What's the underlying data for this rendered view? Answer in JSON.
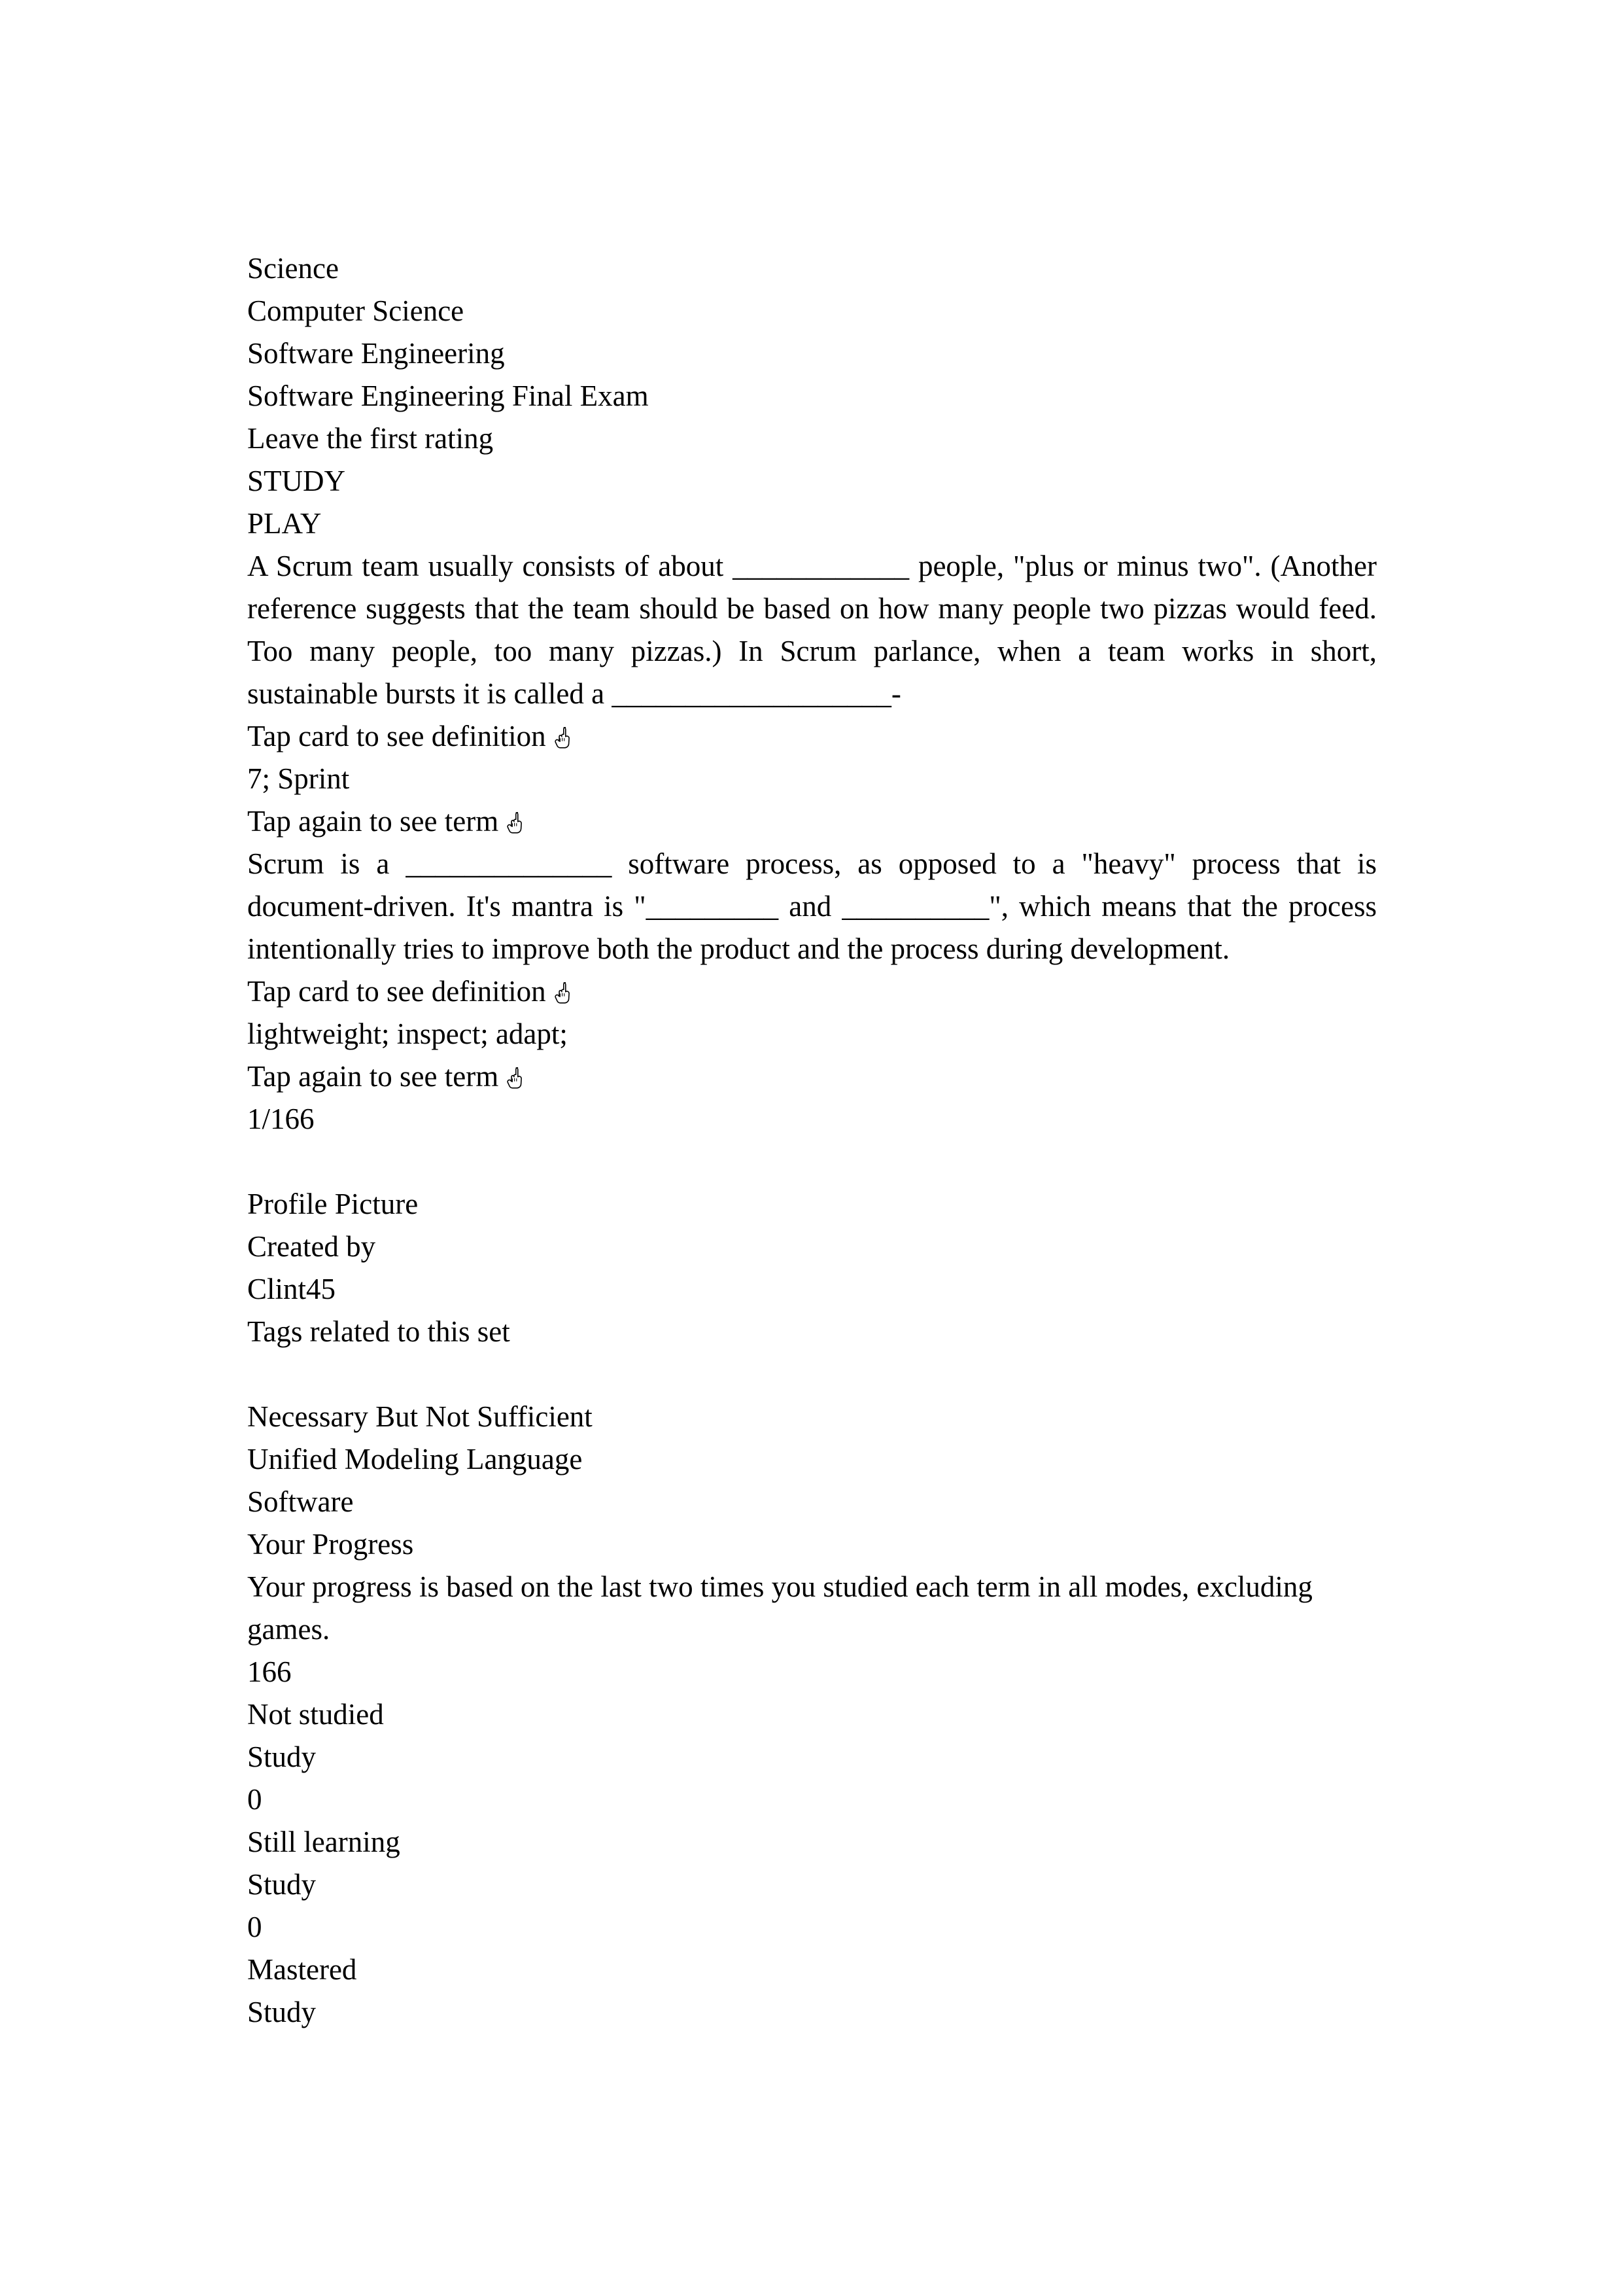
{
  "document": {
    "breadcrumb": [
      "Science",
      "Computer Science",
      "Software Engineering"
    ],
    "set_title": "Software Engineering Final Exam",
    "rating_prompt": "Leave the first rating",
    "mode_buttons": [
      "STUDY",
      "PLAY"
    ],
    "cards": [
      {
        "term_text": "A Scrum team usually consists of about ____________ people, \"plus or minus two\". (Another reference suggests that the team should be based on how many people two pizzas would feed. Too many people, too many pizzas.)\n\nIn Scrum parlance, when a team works in short, sustainable bursts it is called a ___________________-",
        "tap_front_label": "Tap card to see definition",
        "definition_text": "7; Sprint",
        "tap_back_label": "Tap again to see term"
      },
      {
        "term_text": "Scrum is a ______________ software process, as opposed to a \"heavy\" process that is document-driven. It's mantra is \"_________ and __________\", which means that the process intentionally tries to improve both the product and the process during development.",
        "tap_front_label": "Tap card to see definition",
        "definition_text": "lightweight; inspect; adapt;",
        "tap_back_label": "Tap again to see term"
      }
    ],
    "card_counter": "1/166",
    "creator": {
      "profile_picture_label": "Profile Picture",
      "created_by_label": "Created by",
      "username": "Clint45"
    },
    "tags": {
      "heading": "Tags related to this set",
      "items": [
        "Necessary But Not Sufficient",
        "Unified Modeling Language",
        "Software"
      ]
    },
    "progress": {
      "heading": "Your Progress",
      "description": "Your progress is based on the last two times you studied each term in all modes, excluding games.",
      "rows": [
        {
          "count": "166",
          "label": "Not studied",
          "action": "Study"
        },
        {
          "count": "0",
          "label": "Still learning",
          "action": "Study"
        },
        {
          "count": "0",
          "label": "Mastered",
          "action": "Study"
        }
      ]
    },
    "icons": {
      "tap_hand": "white-up-pointing-index-icon"
    }
  }
}
